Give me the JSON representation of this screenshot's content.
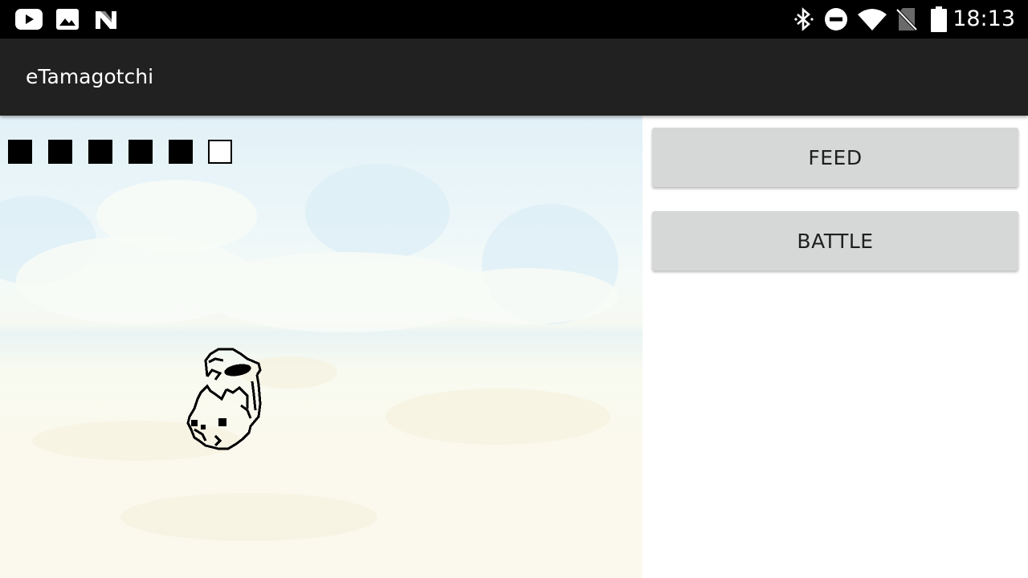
{
  "status_bar": {
    "time": "18:13",
    "left_icons": [
      "youtube-icon",
      "gallery-icon",
      "n-notification-icon"
    ],
    "right_icons": [
      "bluetooth-icon",
      "do-not-disturb-icon",
      "wifi-icon",
      "no-sim-icon",
      "battery-icon"
    ]
  },
  "app_bar": {
    "title": "eTamagotchi"
  },
  "game": {
    "meter": {
      "filled": 5,
      "total": 6
    },
    "pet_icon": "pet-sprite-icon"
  },
  "actions": {
    "feed_label": "FEED",
    "battle_label": "BATTLE"
  },
  "colors": {
    "status_bar_bg": "#000000",
    "app_bar_bg": "#212121",
    "button_bg": "#d6d7d7",
    "button_text": "#1f1f1f"
  }
}
